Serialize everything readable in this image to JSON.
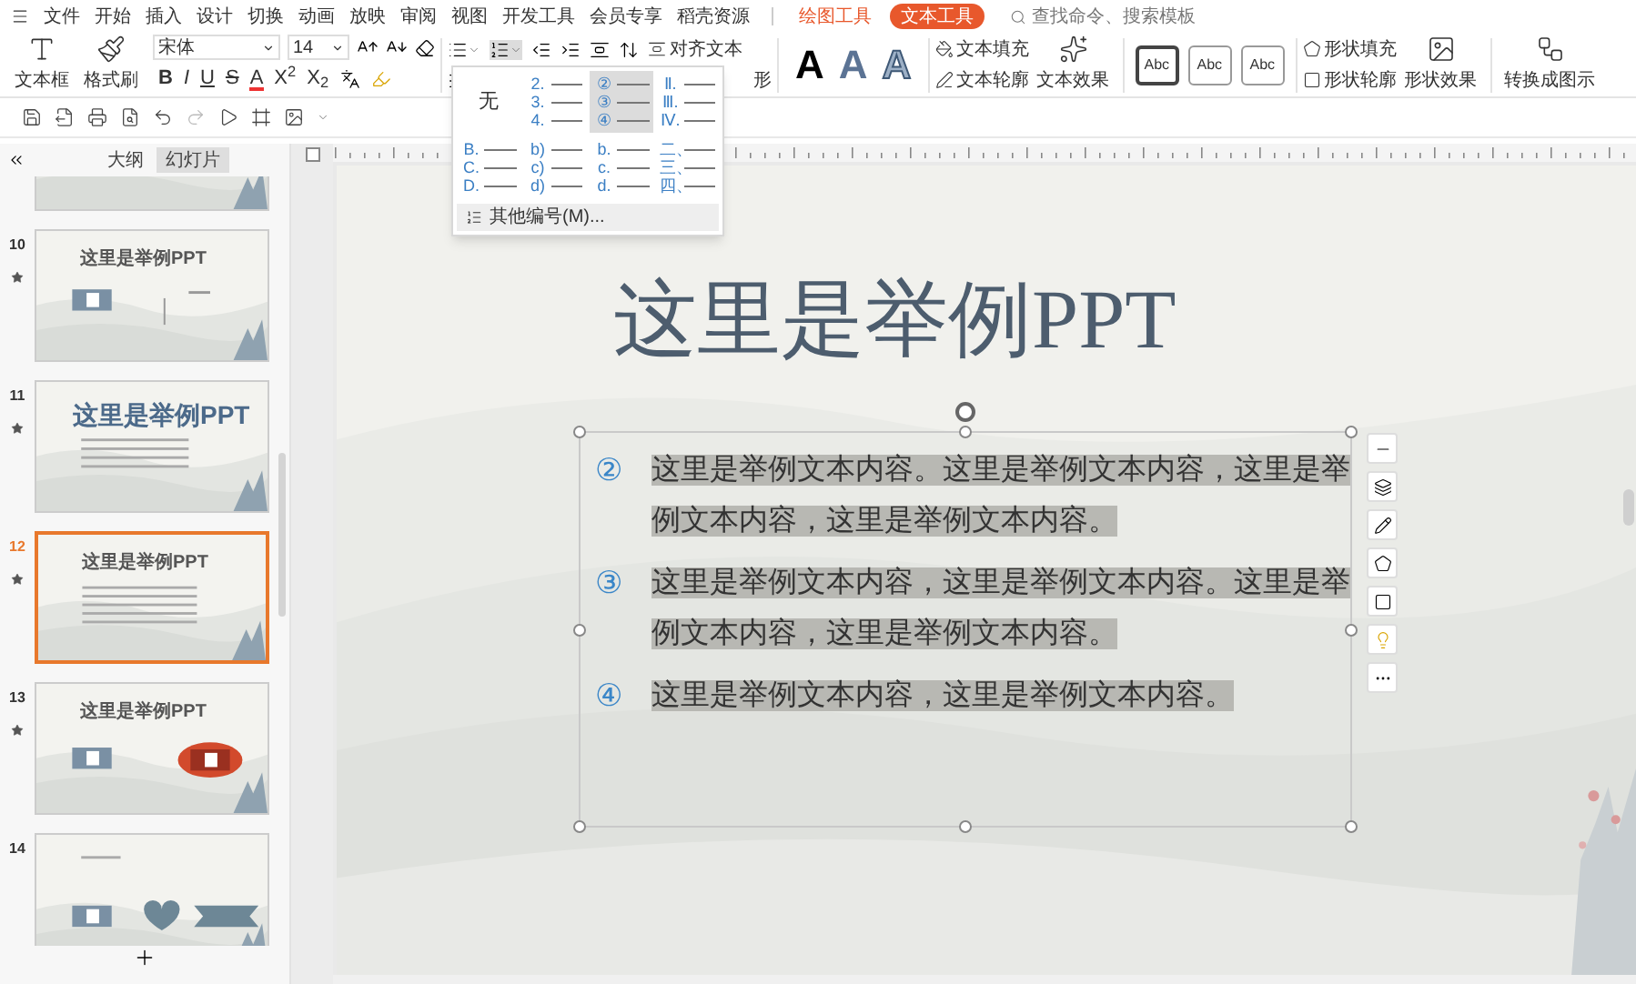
{
  "menu_bar": {
    "items": [
      "文件",
      "开始",
      "插入",
      "设计",
      "切换",
      "动画",
      "放映",
      "审阅",
      "视图",
      "开发工具",
      "会员专享",
      "稻壳资源"
    ],
    "context_tabs": [
      {
        "label": "绘图工具",
        "selected": false
      },
      {
        "label": "文本工具",
        "selected": true
      }
    ],
    "search": {
      "placeholder": "查找命令、搜索模板"
    }
  },
  "ribbon": {
    "text_box": "文本框",
    "format_painter": "格式刷",
    "font": "宋体",
    "font_size": "14",
    "format_buttons": [
      {
        "label": "B",
        "kind": "bold"
      },
      {
        "label": "I",
        "kind": "italic"
      },
      {
        "label": "U",
        "kind": "underline"
      },
      {
        "label": "S",
        "kind": "strike"
      },
      {
        "label": "A",
        "kind": "color"
      },
      {
        "label": "X$^{2}$",
        "kind": "script"
      },
      {
        "label": "X$_{2}$",
        "kind": "script"
      }
    ],
    "numbering_expanded": true,
    "align_text": "对齐文本",
    "text_direction": "形",
    "text_styles": [
      {
        "label": "A",
        "kind": "solid"
      },
      {
        "label": "A",
        "kind": "gradient"
      },
      {
        "label": "A",
        "kind": "outline"
      }
    ],
    "text_fill": "文本填充",
    "text_outline": "文本轮廓",
    "text_effect": "文本效果",
    "shape_styles": [
      {
        "label": "Abc",
        "kind": "dark"
      },
      {
        "label": "Abc",
        "kind": "light"
      },
      {
        "label": "Abc",
        "kind": "light"
      }
    ],
    "shape_fill": "形状填充",
    "shape_outline": "形状轮廓",
    "shape_effect": "形状效果",
    "convert": "转换成图示"
  },
  "numbering_menu": {
    "options": [
      {
        "kind": "none",
        "label": "无",
        "selected": false
      },
      {
        "kind": "list",
        "markers": [
          "2.",
          "3.",
          "4."
        ],
        "selected": false
      },
      {
        "kind": "list",
        "markers": [
          "②",
          "③",
          "④"
        ],
        "selected": true
      },
      {
        "kind": "list",
        "markers": [
          "Ⅱ.",
          "Ⅲ.",
          "Ⅳ."
        ],
        "selected": false
      },
      {
        "kind": "list",
        "markers": [
          "B.",
          "C.",
          "D."
        ],
        "selected": false
      },
      {
        "kind": "list",
        "markers": [
          "b)",
          "c)",
          "d)"
        ],
        "selected": false
      },
      {
        "kind": "list",
        "markers": [
          "b.",
          "c.",
          "d."
        ],
        "selected": false
      },
      {
        "kind": "list",
        "markers": [
          "二、",
          "三、",
          "四、"
        ],
        "selected": false
      }
    ],
    "more": "其他编号(M)..."
  },
  "panel": {
    "tabs": [
      {
        "label": "大纲",
        "selected": false
      },
      {
        "label": "幻灯片",
        "selected": true
      }
    ],
    "slides": [
      {
        "kind": "red-icons",
        "selected": false
      },
      {
        "number": "10",
        "title": "这里是举例PPT",
        "kind": "icon-text",
        "animated": true,
        "selected": false
      },
      {
        "number": "11",
        "title": "这里是举例PPT",
        "kind": "big-title",
        "animated": true,
        "selected": false
      },
      {
        "number": "12",
        "title": "这里是举例PPT",
        "kind": "list",
        "animated": true,
        "selected": true
      },
      {
        "number": "13",
        "title": "这里是举例PPT",
        "kind": "icons-pair",
        "animated": true,
        "selected": false
      },
      {
        "number": "14",
        "kind": "icons-shapes",
        "animated": false,
        "selected": false
      }
    ]
  },
  "slide": {
    "title": "这里是举例PPT",
    "items": [
      {
        "marker": "②",
        "text": "这里是举例文本内容。这里是举例文本内容，这里是举例文本内容，这里是举例文本内容。"
      },
      {
        "marker": "③",
        "text": "这里是举例文本内容，这里是举例文本内容。这里是举例文本内容，这里是举例文本内容。"
      },
      {
        "marker": "④",
        "text": "这里是举例文本内容，这里是举例文本内容。"
      }
    ]
  }
}
